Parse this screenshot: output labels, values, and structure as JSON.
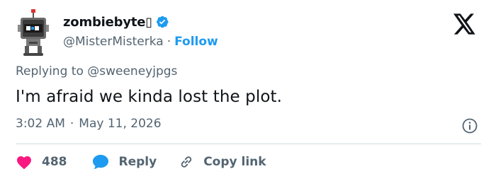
{
  "author": {
    "display_name": "zombiebyte▯",
    "handle": "@MisterMisterka",
    "separator": "·",
    "follow_label": "Follow",
    "avatar_icon": "robot-avatar-icon",
    "verified_icon": "verified-badge-icon"
  },
  "reply_context": {
    "text": "Replying to @sweeneyjpgs"
  },
  "tweet": {
    "text": "I'm afraid we kinda lost the plot.",
    "time": "3:02 AM",
    "separator": "·",
    "date": "May 11, 2026"
  },
  "actions": {
    "like_count": "488",
    "reply_label": "Reply",
    "copy_label": "Copy link"
  },
  "colors": {
    "accent": "#1d9bf0",
    "like": "#f91880",
    "text_primary": "#0f1419",
    "text_secondary": "#536471",
    "divider": "#cfd9de"
  }
}
